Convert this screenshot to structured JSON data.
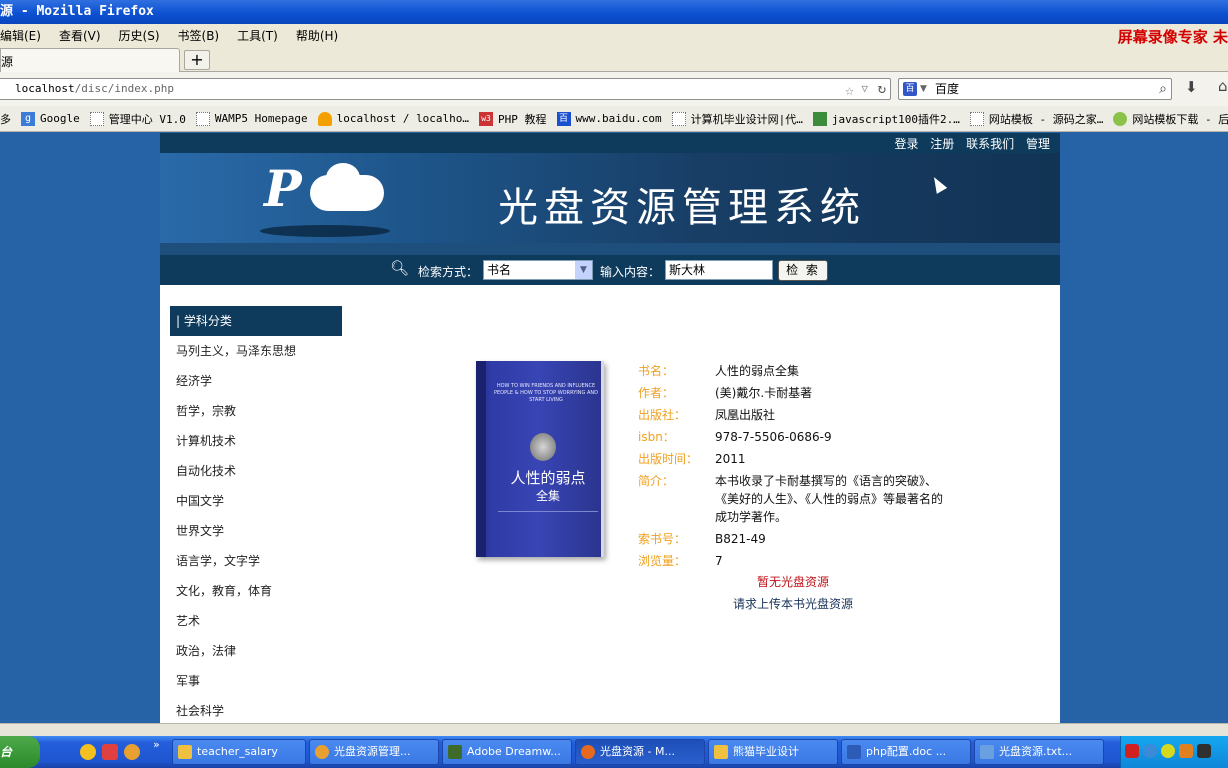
{
  "window": {
    "title": "源 - Mozilla Firefox"
  },
  "menubar": {
    "items": [
      "编辑(E)",
      "查看(V)",
      "历史(S)",
      "书签(B)",
      "工具(T)",
      "帮助(H)"
    ],
    "recorder": "屏幕录像专家 未"
  },
  "tabs": {
    "active_label": "源",
    "new_tab": "+"
  },
  "nav": {
    "url_host": "localhost",
    "url_path": "/disc/index.php",
    "search_placeholder": "百度"
  },
  "bookmarks": [
    "多",
    "Google",
    "管理中心 V1.0",
    "WAMP5 Homepage",
    "localhost / localho…",
    "PHP 教程",
    "www.baidu.com",
    "计算机毕业设计网|代…",
    "javascript100插件2.…",
    "网站模板 - 源码之家…",
    "网站模板下载 - 后台"
  ],
  "site": {
    "top_links": [
      "登录",
      "注册",
      "联系我们",
      "管理"
    ],
    "title": "光盘资源管理系统",
    "logo_letter": "P"
  },
  "search": {
    "method_label": "检索方式：",
    "method_value": "书名",
    "input_label": "输入内容：",
    "input_value": "斯大林",
    "button": "检 索"
  },
  "sidebar": {
    "header": "| 学科分类",
    "categories": [
      "马列主义，马泽东思想",
      "经济学",
      "哲学，宗教",
      "计算机技术",
      "自动化技术",
      "中国文学",
      "世界文学",
      "语言学，文字学",
      "文化，教育，体育",
      "艺术",
      "政治，法律",
      "军事",
      "社会科学"
    ]
  },
  "book": {
    "cover_en": "HOW TO WIN FRIENDS AND INFLUENCE PEOPLE & HOW TO STOP WORRYING AND START LIVING",
    "cover_title": "人性的弱点",
    "cover_subtitle": "全集",
    "fields": [
      {
        "key": "书名：",
        "value": "人性的弱点全集"
      },
      {
        "key": "作者：",
        "value": "(美)戴尔.卡耐基著"
      },
      {
        "key": "出版社：",
        "value": "凤凰出版社"
      },
      {
        "key": "isbn：",
        "value": "978-7-5506-0686-9"
      },
      {
        "key": "出版时间：",
        "value": "2011"
      },
      {
        "key": "简介：",
        "value": "本书收录了卡耐基撰写的《语言的突破》、《美好的人生》、《人性的弱点》等最著名的成功学著作。"
      },
      {
        "key": "索书号：",
        "value": "B821-49"
      },
      {
        "key": "浏览量：",
        "value": "7"
      }
    ],
    "no_resource": "暂无光盘资源",
    "request_upload": "请求上传本书光盘资源"
  },
  "taskbar": {
    "start": "台",
    "tasks": [
      "teacher_salary",
      "光盘资源管理...",
      "Adobe Dreamw...",
      "光盘资源 - M...",
      "熊猫毕业设计",
      "php配置.doc ...",
      "光盘资源.txt..."
    ]
  },
  "colors": {
    "page_bg": "#2563a6",
    "header_dark": "#0e3a5c",
    "label_orange": "#f0a020",
    "alert_red": "#c0121a"
  }
}
